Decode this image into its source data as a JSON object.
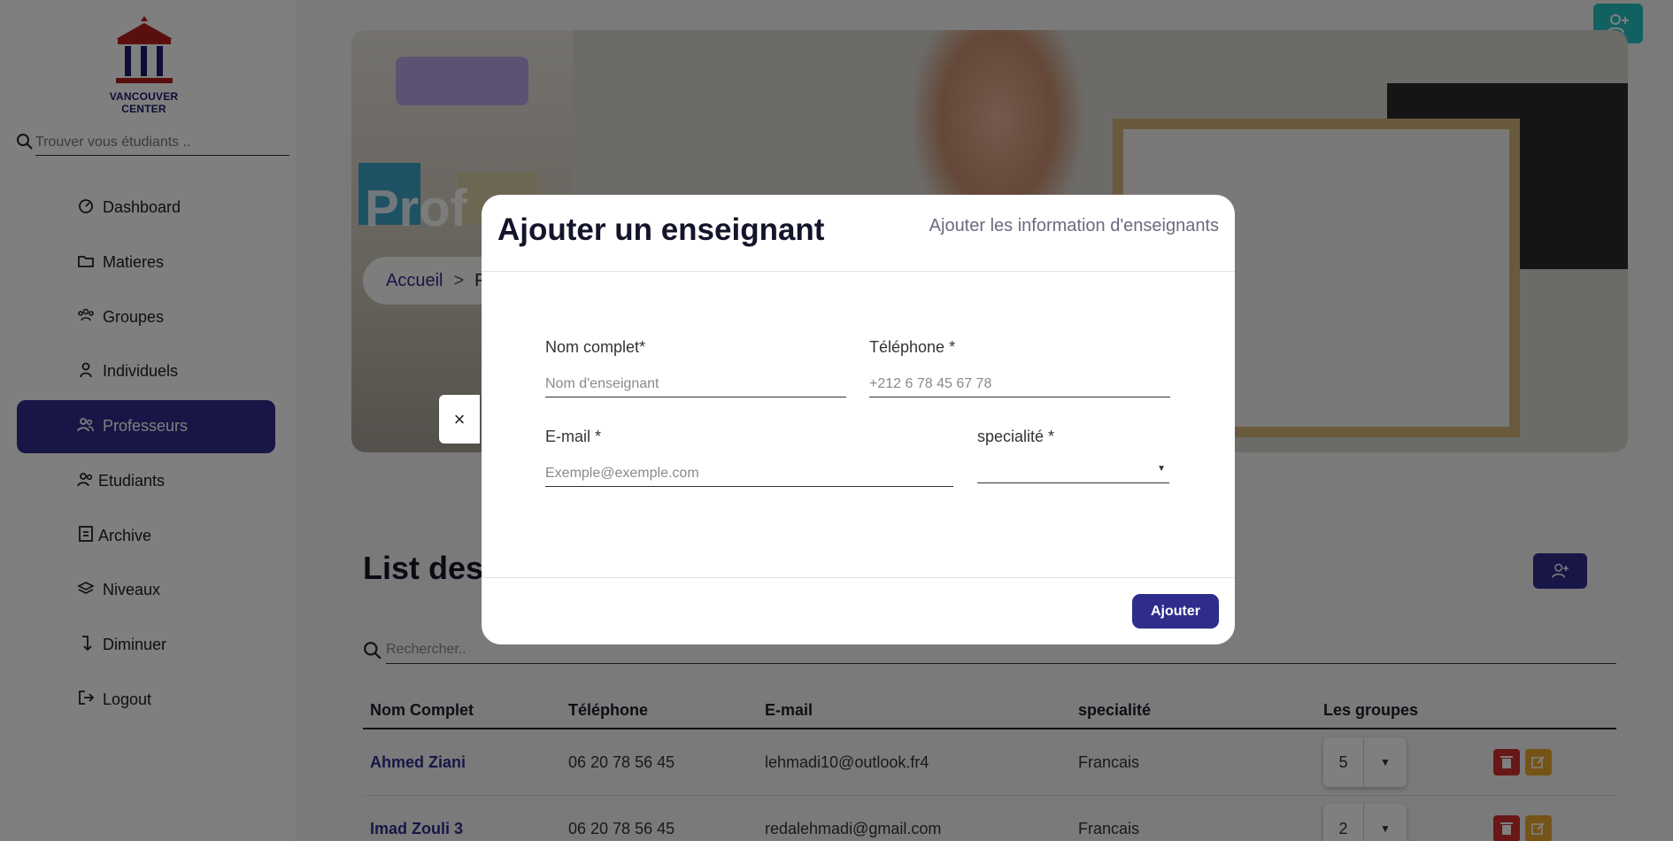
{
  "brand": {
    "name": "VANCOUVER CENTER"
  },
  "sidebar": {
    "search_placeholder": "Trouver vous étudiants ..",
    "items": [
      {
        "label": "Dashboard",
        "icon": "dashboard-icon"
      },
      {
        "label": "Matieres",
        "icon": "folder-icon"
      },
      {
        "label": "Groupes",
        "icon": "groups-icon"
      },
      {
        "label": "Individuels",
        "icon": "user-icon"
      },
      {
        "label": "Professeurs",
        "icon": "users-icon",
        "active": true
      },
      {
        "label": "Etudiants",
        "icon": "students-icon"
      },
      {
        "label": "Archive",
        "icon": "archive-icon"
      },
      {
        "label": "Niveaux",
        "icon": "layers-icon"
      },
      {
        "label": "Diminuer",
        "icon": "arrow-down-icon"
      },
      {
        "label": "Logout",
        "icon": "logout-icon"
      }
    ]
  },
  "hero": {
    "title": "Prof",
    "breadcrumb_home": "Accueil",
    "breadcrumb_sep": ">",
    "breadcrumb_current": "P"
  },
  "list": {
    "title": "List des",
    "search_placeholder": "Rechercher.."
  },
  "table": {
    "headers": [
      "Nom Complet",
      "Téléphone",
      "E-mail",
      "specialité",
      "Les groupes",
      ""
    ],
    "rows": [
      {
        "name": "Ahmed Ziani",
        "phone": "06 20 78 56 45",
        "email": "lehmadi10@outlook.fr4",
        "spec": "Francais",
        "groups": "5"
      },
      {
        "name": "Imad Zouli 3",
        "phone": "06 20 78 56 45",
        "email": "redalehmadi@gmail.com",
        "spec": "Francais",
        "groups": "2"
      }
    ]
  },
  "modal": {
    "close_label": "×",
    "title": "Ajouter un enseignant",
    "subtitle": "Ajouter les information d'enseignants",
    "name_label": "Nom complet*",
    "name_placeholder": "Nom d'enseignant",
    "tel_label": "Téléphone *",
    "tel_placeholder": "+212 6 78 45 67 78",
    "email_label": "E-mail *",
    "email_placeholder": "Exemple@exemple.com",
    "spec_label": "specialité *",
    "spec_value": "",
    "submit_label": "Ajouter"
  },
  "colors": {
    "primary": "#2e2d8c",
    "teal": "#25c3c3",
    "danger": "#d0312d",
    "warning": "#e9a92c"
  }
}
